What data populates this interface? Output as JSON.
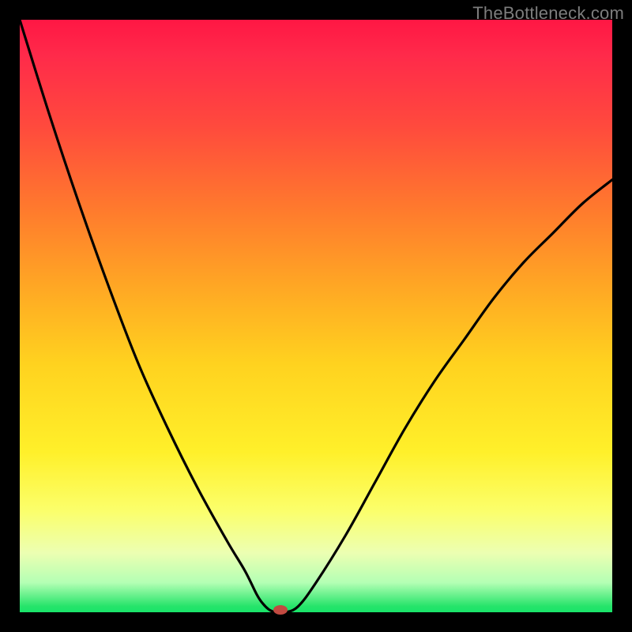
{
  "watermark": "TheBottleneck.com",
  "chart_data": {
    "type": "line",
    "title": "",
    "xlabel": "",
    "ylabel": "",
    "xlim": [
      0,
      100
    ],
    "ylim": [
      0,
      100
    ],
    "grid": false,
    "legend": false,
    "series": [
      {
        "name": "left-curve",
        "x": [
          0,
          5,
          10,
          15,
          20,
          25,
          30,
          35,
          38,
          40,
          41,
          42,
          43
        ],
        "y": [
          100,
          84,
          69,
          55,
          42,
          31,
          21,
          12,
          7,
          3,
          1.5,
          0.5,
          0
        ]
      },
      {
        "name": "right-curve",
        "x": [
          45,
          47,
          50,
          55,
          60,
          65,
          70,
          75,
          80,
          85,
          90,
          95,
          100
        ],
        "y": [
          0,
          1,
          5,
          13,
          22,
          31,
          39,
          46,
          53,
          59,
          64,
          69,
          73
        ]
      }
    ],
    "flat_segment": {
      "x": [
        43,
        45
      ],
      "y": 0
    },
    "marker": {
      "x": 44,
      "y": 0,
      "color": "#c24a41"
    },
    "background_gradient": {
      "top": "#ff1744",
      "middle": "#ffd21f",
      "bottom": "#19e46a"
    }
  }
}
